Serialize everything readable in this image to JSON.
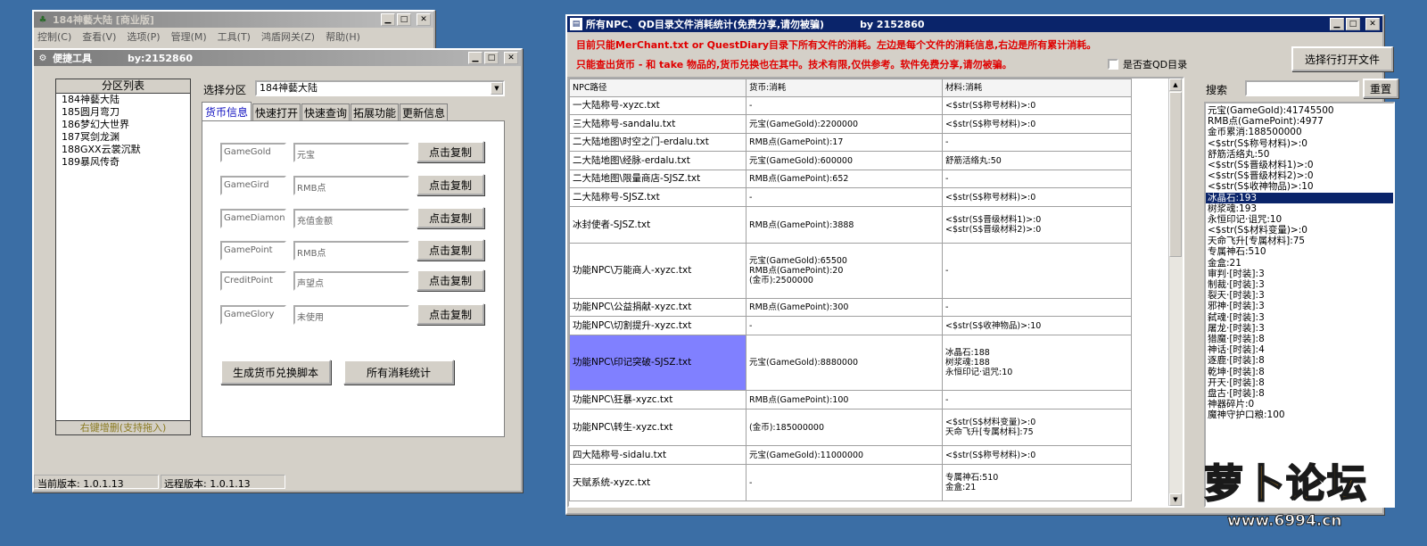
{
  "main_window": {
    "title": "184神藝大陆 [商业版]",
    "menus": [
      "控制(C)",
      "查看(V)",
      "选项(P)",
      "管理(M)",
      "工具(T)",
      "鸿盾网关(Z)",
      "帮助(H)"
    ]
  },
  "quick_tool": {
    "title": "便捷工具",
    "by": "by:2152860",
    "partition_list_header": "分区列表",
    "partitions": [
      "184神藝大陆",
      "185圆月弯刀",
      "186梦幻大世界",
      "187冥剑龙渊",
      "188GXX云裳沉默",
      "189暴风传奇"
    ],
    "partition_footer": "右键增删(支持拖入)",
    "select_label": "选择分区",
    "select_value": "184神藝大陆",
    "tabs": [
      "货币信息",
      "快速打开",
      "快速查询",
      "拓展功能",
      "更新信息"
    ],
    "currency_rows": [
      {
        "key": "GameGold",
        "name": "元宝",
        "button": "点击复制"
      },
      {
        "key": "GameGird",
        "name": "RMB点",
        "button": "点击复制"
      },
      {
        "key": "GameDiamond",
        "name": "充值金额",
        "button": "点击复制"
      },
      {
        "key": "GamePoint",
        "name": "RMB点",
        "button": "点击复制"
      },
      {
        "key": "CreditPoint",
        "name": "声望点",
        "button": "点击复制"
      },
      {
        "key": "GameGlory",
        "name": "未使用",
        "button": "点击复制"
      }
    ],
    "gen_script_button": "生成货币兑换脚本",
    "stats_button": "所有消耗统计",
    "current_version": "当前版本: 1.0.1.13",
    "remote_version": "远程版本: 1.0.1.13"
  },
  "stats_window": {
    "title": "所有NPC、QD目录文件消耗统计(免费分享,请勿被骗)",
    "by": "by 2152860",
    "info_line1": "目前只能MerChant.txt or QuestDiary目录下所有文件的消耗。左边是每个文件的消耗信息,右边是所有累计消耗。",
    "info_line2": "只能查出货币 - 和 take 物品的,货币兑换也在其中。技术有限,仅供参考。软件免费分享,请勿被骗。",
    "checkbox_label": "是否查QD目录",
    "open_button": "选择行打开文件",
    "search_label": "搜索",
    "reset_button": "重置",
    "columns": [
      "NPC路径",
      "货币:消耗",
      "材料:消耗"
    ],
    "rows": [
      {
        "path": "一大陆称号-xyzc.txt",
        "currency": "-",
        "material": "<$str(S$称号材料)>:0"
      },
      {
        "path": "三大陆称号-sandalu.txt",
        "currency": "元宝(GameGold):2200000",
        "material": "<$str(S$称号材料)>:0"
      },
      {
        "path": "二大陆地图\\时空之门-erdalu.txt",
        "currency": "RMB点(GamePoint):17",
        "material": "-"
      },
      {
        "path": "二大陆地图\\经脉-erdalu.txt",
        "currency": "元宝(GameGold):600000",
        "material": "舒筋活络丸:50"
      },
      {
        "path": "二大陆地图\\限量商店-SJSZ.txt",
        "currency": "RMB点(GamePoint):652",
        "material": "-"
      },
      {
        "path": "二大陆称号-SJSZ.txt",
        "currency": "-",
        "material": "<$str(S$称号材料)>:0"
      },
      {
        "path": "冰封使者-SJSZ.txt",
        "currency": "RMB点(GamePoint):3888",
        "material": "<$str(S$晋级材料1)>:0\n<$str(S$晋级材料2)>:0"
      },
      {
        "path": "功能NPC\\万能商人-xyzc.txt",
        "currency": "元宝(GameGold):65500\nRMB点(GamePoint):20\n(金币):2500000",
        "material": "-"
      },
      {
        "path": "功能NPC\\公益捐献-xyzc.txt",
        "currency": "RMB点(GamePoint):300",
        "material": "-"
      },
      {
        "path": "功能NPC\\切割提升-xyzc.txt",
        "currency": "-",
        "material": "<$str(S$收神物品)>:10"
      },
      {
        "path": "功能NPC\\印记突破-SJSZ.txt",
        "currency": "元宝(GameGold):8880000",
        "material": "冰晶石:188\n树浆魂:188\n永恒印记·诅咒:10"
      },
      {
        "path": "功能NPC\\狂暴-xyzc.txt",
        "currency": "RMB点(GamePoint):100",
        "material": "-"
      },
      {
        "path": "功能NPC\\转生-xyzc.txt",
        "currency": "(金币):185000000",
        "material": "<$str(S$材料变量)>:0\n天命飞升[专属材料]:75"
      },
      {
        "path": "四大陆称号-sidalu.txt",
        "currency": "元宝(GameGold):11000000",
        "material": "<$str(S$称号材料)>:0"
      },
      {
        "path": "天赋系统-xyzc.txt",
        "currency": "-",
        "material": "专属神石:510\n金盒:21"
      }
    ],
    "totals": [
      "元宝(GameGold):41745500",
      "RMB点(GamePoint):4977",
      "金币累消:188500000",
      "<$str(S$称号材料)>:0",
      "舒筋活络丸:50",
      "<$str(S$晋级材料1)>:0",
      "<$str(S$晋级材料2)>:0",
      "<$str(S$收神物品)>:10",
      "冰晶石:193",
      "树浆魂:193",
      "永恒印记·诅咒:10",
      "<$str(S$材料变量)>:0",
      "天命飞升[专属材料]:75",
      "专属神石:510",
      "金盒:21",
      "审判·[时装]:3",
      "制裁·[时装]:3",
      "裂天·[时装]:3",
      "邪神·[时装]:3",
      "弑魂·[时装]:3",
      "屠龙·[时装]:3",
      "猎魔·[时装]:8",
      "神话·[时装]:4",
      "逐鹿·[时装]:8",
      "乾坤·[时装]:8",
      "开天·[时装]:8",
      "盘古·[时装]:8",
      "神器碎片:0",
      "魔神守护口粮:100"
    ],
    "selected_total_index": 8
  },
  "watermark": {
    "text": "萝卜论坛",
    "url": "www.6994.cn"
  },
  "colors": {
    "desktop": "#3b6ea5",
    "title_active": "#0a246a",
    "selected_row": "#8080ff",
    "red_text": "#e00000"
  }
}
